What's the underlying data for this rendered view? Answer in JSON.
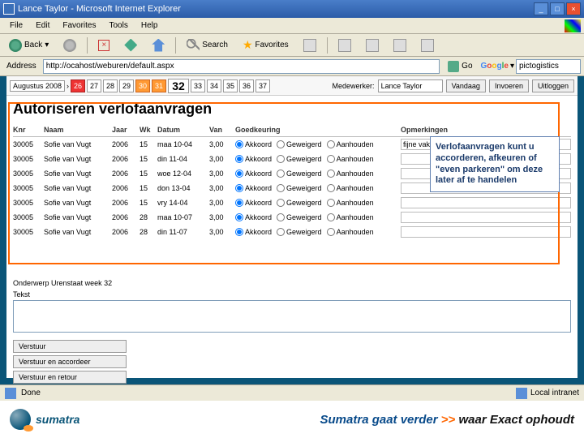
{
  "window": {
    "title": "Lance Taylor - Microsoft Internet Explorer"
  },
  "menu": {
    "file": "File",
    "edit": "Edit",
    "favorites": "Favorites",
    "tools": "Tools",
    "help": "Help"
  },
  "toolbar": {
    "back": "Back",
    "search": "Search",
    "favorites": "Favorites"
  },
  "address": {
    "label": "Address",
    "url": "http://ocahost/weburen/default.aspx",
    "go": "Go",
    "google": "Google",
    "search_value": "pictogistics"
  },
  "datebar": {
    "month": "Augustus 2008",
    "arrow": "›",
    "days": [
      "26",
      "27",
      "28",
      "29",
      "30",
      "31",
      "32",
      "33",
      "34",
      "35",
      "36",
      "37"
    ],
    "mw_label": "Medewerker:",
    "mw_value": "Lance Taylor",
    "btn_vandaag": "Vandaag",
    "btn_invoeren": "Invoeren",
    "btn_uitloggen": "Uitloggen"
  },
  "page_title": "Autoriseren verlofaanvragen",
  "table": {
    "headers": {
      "knr": "Knr",
      "naam": "Naam",
      "jaar": "Jaar",
      "wk": "Wk",
      "datum": "Datum",
      "van": "Van",
      "goed": "Goedkeuring",
      "opm": "Opmerkingen"
    },
    "radio": {
      "akkoord": "Akkoord",
      "geweigerd": "Geweigerd",
      "aanhouden": "Aanhouden"
    },
    "rows": [
      {
        "knr": "30005",
        "naam": "Sofie van Vugt",
        "jaar": "2006",
        "wk": "15",
        "datum": "maa 10-04",
        "van": "3,00",
        "opm": "fijne vakantie!"
      },
      {
        "knr": "30005",
        "naam": "Sofie van Vugt",
        "jaar": "2006",
        "wk": "15",
        "datum": "din 11-04",
        "van": "3,00",
        "opm": ""
      },
      {
        "knr": "30005",
        "naam": "Sofie van Vugt",
        "jaar": "2006",
        "wk": "15",
        "datum": "woe 12-04",
        "van": "3,00",
        "opm": ""
      },
      {
        "knr": "30005",
        "naam": "Sofie van Vugt",
        "jaar": "2006",
        "wk": "15",
        "datum": "don 13-04",
        "van": "3,00",
        "opm": ""
      },
      {
        "knr": "30005",
        "naam": "Sofie van Vugt",
        "jaar": "2006",
        "wk": "15",
        "datum": "vry 14-04",
        "van": "3,00",
        "opm": ""
      },
      {
        "knr": "30005",
        "naam": "Sofie van Vugt",
        "jaar": "2006",
        "wk": "28",
        "datum": "maa 10-07",
        "van": "3,00",
        "opm": ""
      },
      {
        "knr": "30005",
        "naam": "Sofie van Vugt",
        "jaar": "2006",
        "wk": "28",
        "datum": "din 11-07",
        "van": "3,00",
        "opm": ""
      }
    ]
  },
  "callout": "Verlofaanvragen kunt u accorderen, afkeuren of \"even parkeren\" om deze later af te handelen",
  "lower": {
    "onderwerp_label": "Onderwerp",
    "onderwerp_value": "Urenstaat week 32",
    "tekst_label": "Tekst",
    "btn_verstuur": "Verstuur",
    "btn_verstuur_acc": "Verstuur en accordeer",
    "btn_verstuur_ret": "Verstuur en retour"
  },
  "status": {
    "done": "Done",
    "zone": "Local intranet"
  },
  "footer": {
    "brand": "sumatra",
    "s1": "Sumatra gaat verder",
    "arrows": ">>",
    "s2": "waar Exact ophoudt"
  }
}
